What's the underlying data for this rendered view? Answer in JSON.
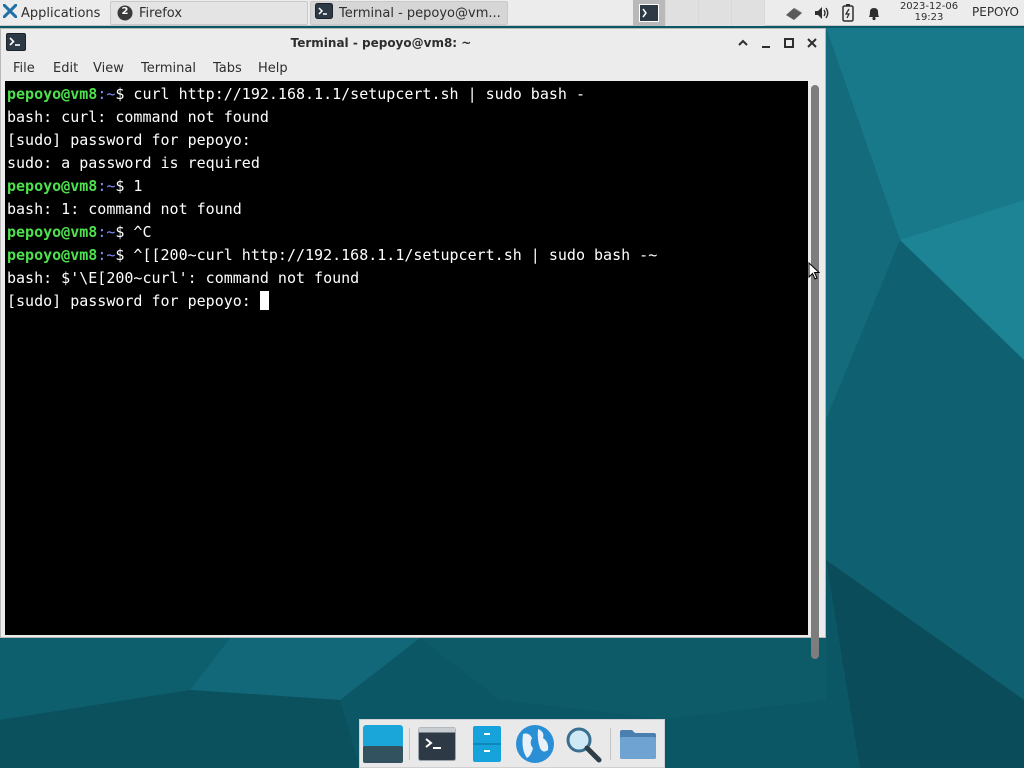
{
  "top_panel": {
    "applications_label": "Applications",
    "tasks": [
      {
        "label": "Firefox",
        "badge": "2",
        "icon": "firefox-icon"
      },
      {
        "label": "Terminal - pepoyo@vm...",
        "icon": "terminal-icon"
      }
    ],
    "workspaces": [
      "1",
      "2",
      "3",
      "4"
    ],
    "tray_icons": [
      "network-icon",
      "volume-icon",
      "battery-icon",
      "bell-icon"
    ],
    "clock_date": "2023-12-06",
    "clock_time": "19:23",
    "user": "PEPOYO"
  },
  "window": {
    "title": "Terminal - pepoyo@vm8: ~",
    "menu": [
      "File",
      "Edit",
      "View",
      "Terminal",
      "Tabs",
      "Help"
    ]
  },
  "terminal": {
    "lines": [
      {
        "user": "pepoyo@vm8",
        "path": ":~",
        "text": "$ curl http://192.168.1.1/setupcert.sh | sudo bash -"
      },
      {
        "text": "bash: curl: command not found"
      },
      {
        "text": "[sudo] password for pepoyo:"
      },
      {
        "text": "sudo: a password is required"
      },
      {
        "user": "pepoyo@vm8",
        "path": ":~",
        "text": "$ 1"
      },
      {
        "text": "bash: 1: command not found"
      },
      {
        "user": "pepoyo@vm8",
        "path": ":~",
        "text": "$ ^C"
      },
      {
        "user": "pepoyo@vm8",
        "path": ":~",
        "text": "$ ^[[200~curl http://192.168.1.1/setupcert.sh | sudo bash -~"
      },
      {
        "text": "bash: $'\\E[200~curl': command not found"
      },
      {
        "text": "[sudo] password for pepoyo: "
      }
    ]
  },
  "colors": {
    "prompt_user": "#4ee14e",
    "prompt_path": "#7f8fff",
    "desktop": "#0d5a6b"
  },
  "dock": [
    "show-desktop-icon",
    "terminal-icon",
    "file-manager-icon",
    "web-browser-icon",
    "app-finder-icon",
    "folder-icon"
  ]
}
